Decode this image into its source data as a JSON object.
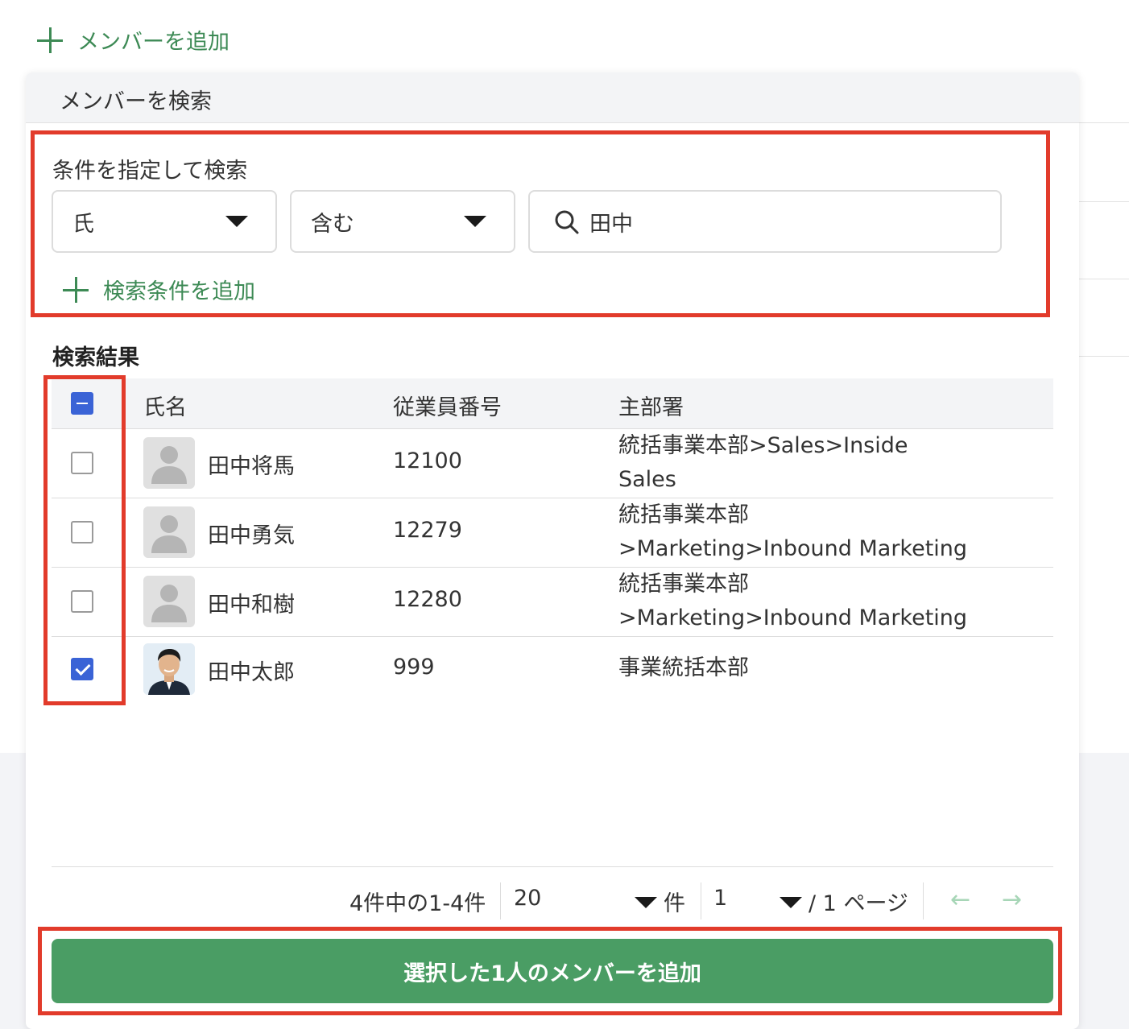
{
  "page": {
    "add_member_link": "メンバーを追加"
  },
  "dialog": {
    "title": "メンバーを検索",
    "condition_section_label": "条件を指定して検索",
    "field_select_value": "氏",
    "operator_select_value": "含む",
    "search_value": "田中",
    "add_condition_label": "検索条件を追加",
    "results_label": "検索結果",
    "table": {
      "headers": [
        "氏名",
        "従業員番号",
        "主部署"
      ],
      "rows": [
        {
          "name": "田中将馬",
          "employee_no": "12100",
          "dept_line1": "統括事業本部>Sales>Inside",
          "dept_line2": "Sales",
          "checked": false,
          "avatar": "placeholder-avatar"
        },
        {
          "name": "田中勇気",
          "employee_no": "12279",
          "dept_line1": "統括事業本部",
          "dept_line2": ">Marketing>Inbound Marketing",
          "checked": false,
          "avatar": "placeholder-avatar"
        },
        {
          "name": "田中和樹",
          "employee_no": "12280",
          "dept_line1": "統括事業本部",
          "dept_line2": ">Marketing>Inbound Marketing",
          "checked": false,
          "avatar": "placeholder-avatar"
        },
        {
          "name": "田中太郎",
          "employee_no": "999",
          "dept_line1": "事業統括本部",
          "dept_line2": "",
          "checked": true,
          "avatar": "photo-avatar"
        }
      ]
    },
    "pagination": {
      "summary": "4件中の1-4件",
      "per_page": "20",
      "per_page_unit": "件",
      "page": "1",
      "page_suffix": "/ 1 ページ"
    },
    "submit_label": "選択した1人のメンバーを追加"
  },
  "colors": {
    "accent_green": "#4a9d64",
    "link_green": "#3d8a55",
    "checkbox_blue": "#3a63d6",
    "highlight_red": "#e23b2b"
  }
}
